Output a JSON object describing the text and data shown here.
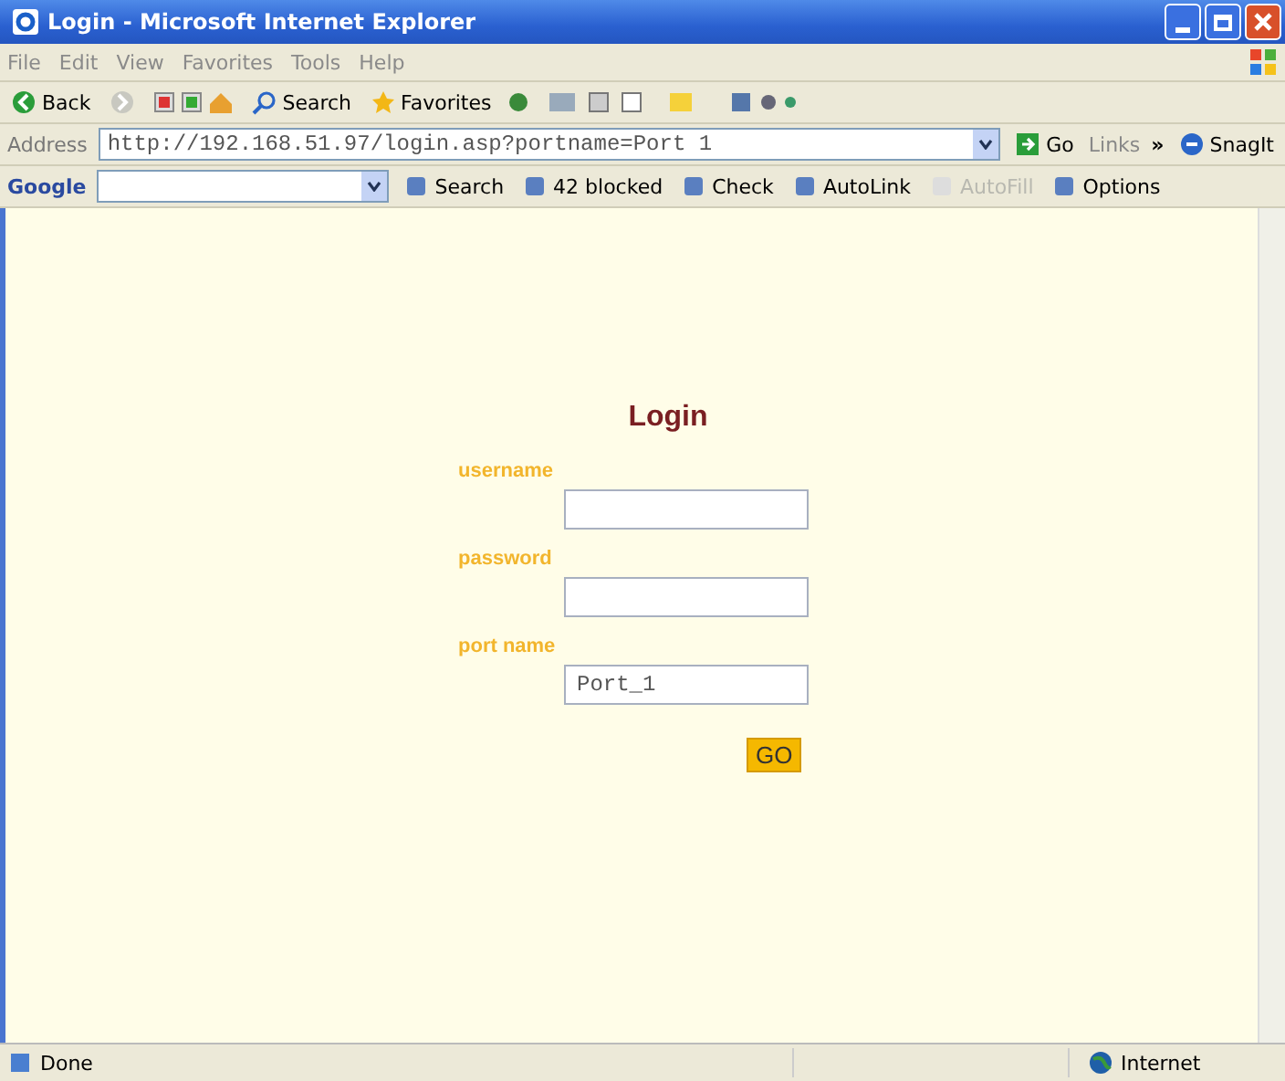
{
  "window": {
    "title": "Login - Microsoft Internet Explorer"
  },
  "menu": [
    "File",
    "Edit",
    "View",
    "Favorites",
    "Tools",
    "Help"
  ],
  "toolbar": [
    {
      "kind": "back",
      "label": "Back"
    },
    {
      "kind": "forward"
    },
    {
      "kind": "search",
      "label": "Search"
    },
    {
      "kind": "favorites",
      "label": "Favorites"
    }
  ],
  "address_bar": {
    "label": "Address",
    "url": "http://192.168.51.97/login.asp?portname=Port 1",
    "go": "Go",
    "links": "Links",
    "chevron": "»",
    "snagit": "SnagIt"
  },
  "google_toolbar": {
    "logo": "Google",
    "items": [
      {
        "label": "Search",
        "disabled": false
      },
      {
        "label": "42 blocked",
        "disabled": false
      },
      {
        "label": "Check",
        "disabled": false
      },
      {
        "label": "AutoLink",
        "disabled": false
      },
      {
        "label": "AutoFill",
        "disabled": true
      },
      {
        "label": "Options",
        "disabled": false
      }
    ]
  },
  "login": {
    "title": "Login",
    "fields": [
      {
        "label": "username"
      },
      {
        "label": "password"
      },
      {
        "label": "port name",
        "value": "Port_1"
      }
    ],
    "button": "GO"
  },
  "status_bar": {
    "text": "Done",
    "zone": "Internet"
  }
}
